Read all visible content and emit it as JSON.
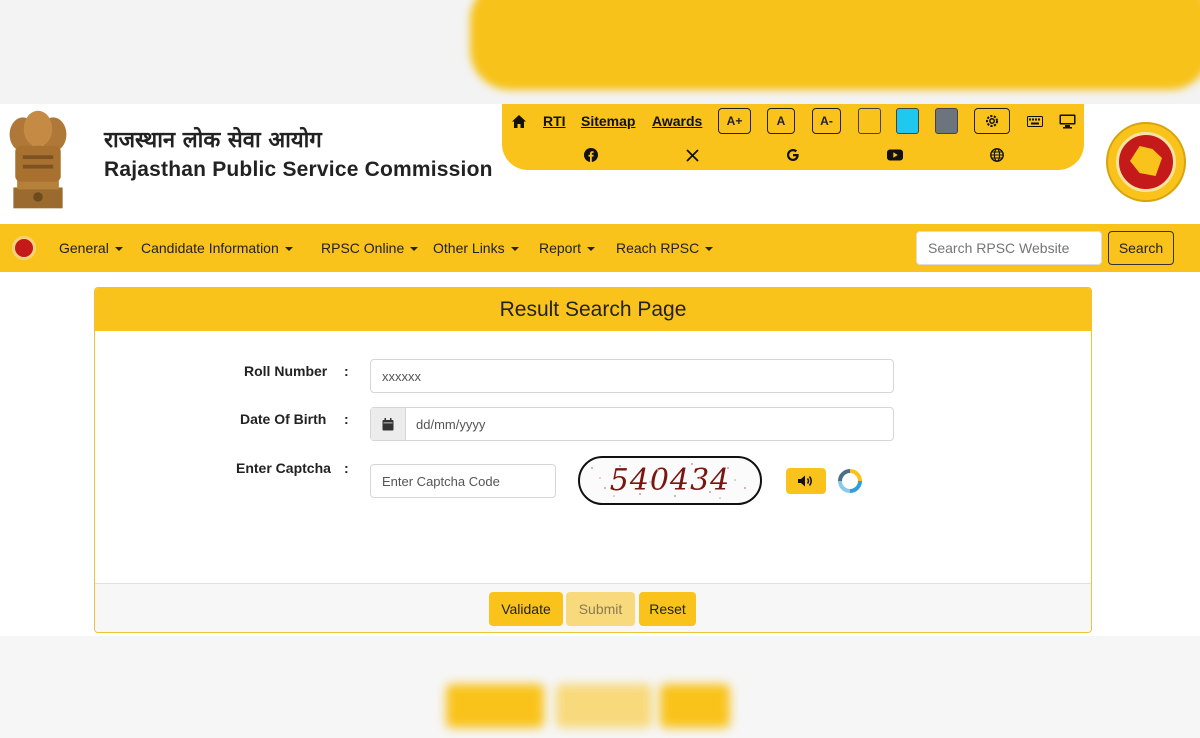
{
  "header": {
    "org_name_hindi": "राजस्थान लोक सेवा आयोग",
    "org_name_english": "Rajasthan Public Service Commission"
  },
  "toolbar": {
    "links": {
      "rti": "RTI",
      "sitemap": "Sitemap",
      "awards": "Awards"
    },
    "font_buttons": {
      "increase": "A+",
      "normal": "A",
      "decrease": "A-"
    },
    "theme_swatches": [
      "#f9c31b",
      "#1ec8ee",
      "#6c757d"
    ],
    "icons": [
      "home-icon",
      "settings-icon",
      "keyboard-icon",
      "monitor-icon",
      "facebook-icon",
      "x-icon",
      "google-icon",
      "youtube-icon",
      "globe-icon"
    ]
  },
  "nav": {
    "items": [
      "General",
      "Candidate Information",
      "RPSC Online",
      "Other Links",
      "Report",
      "Reach RPSC"
    ],
    "search_placeholder": "Search RPSC Website",
    "search_button": "Search"
  },
  "form": {
    "title": "Result Search Page",
    "roll_number_label": "Roll Number",
    "roll_number_value": "xxxxxx",
    "dob_label": "Date Of Birth",
    "dob_placeholder": "dd/mm/yyyy",
    "captcha_label": "Enter Captcha",
    "captcha_placeholder": "Enter Captcha Code",
    "captcha_text": "540434",
    "colon": ":"
  },
  "buttons": {
    "validate": "Validate",
    "submit": "Submit",
    "reset": "Reset"
  },
  "colors": {
    "accent": "#f9c31b",
    "seal_red": "#c41a1a"
  }
}
